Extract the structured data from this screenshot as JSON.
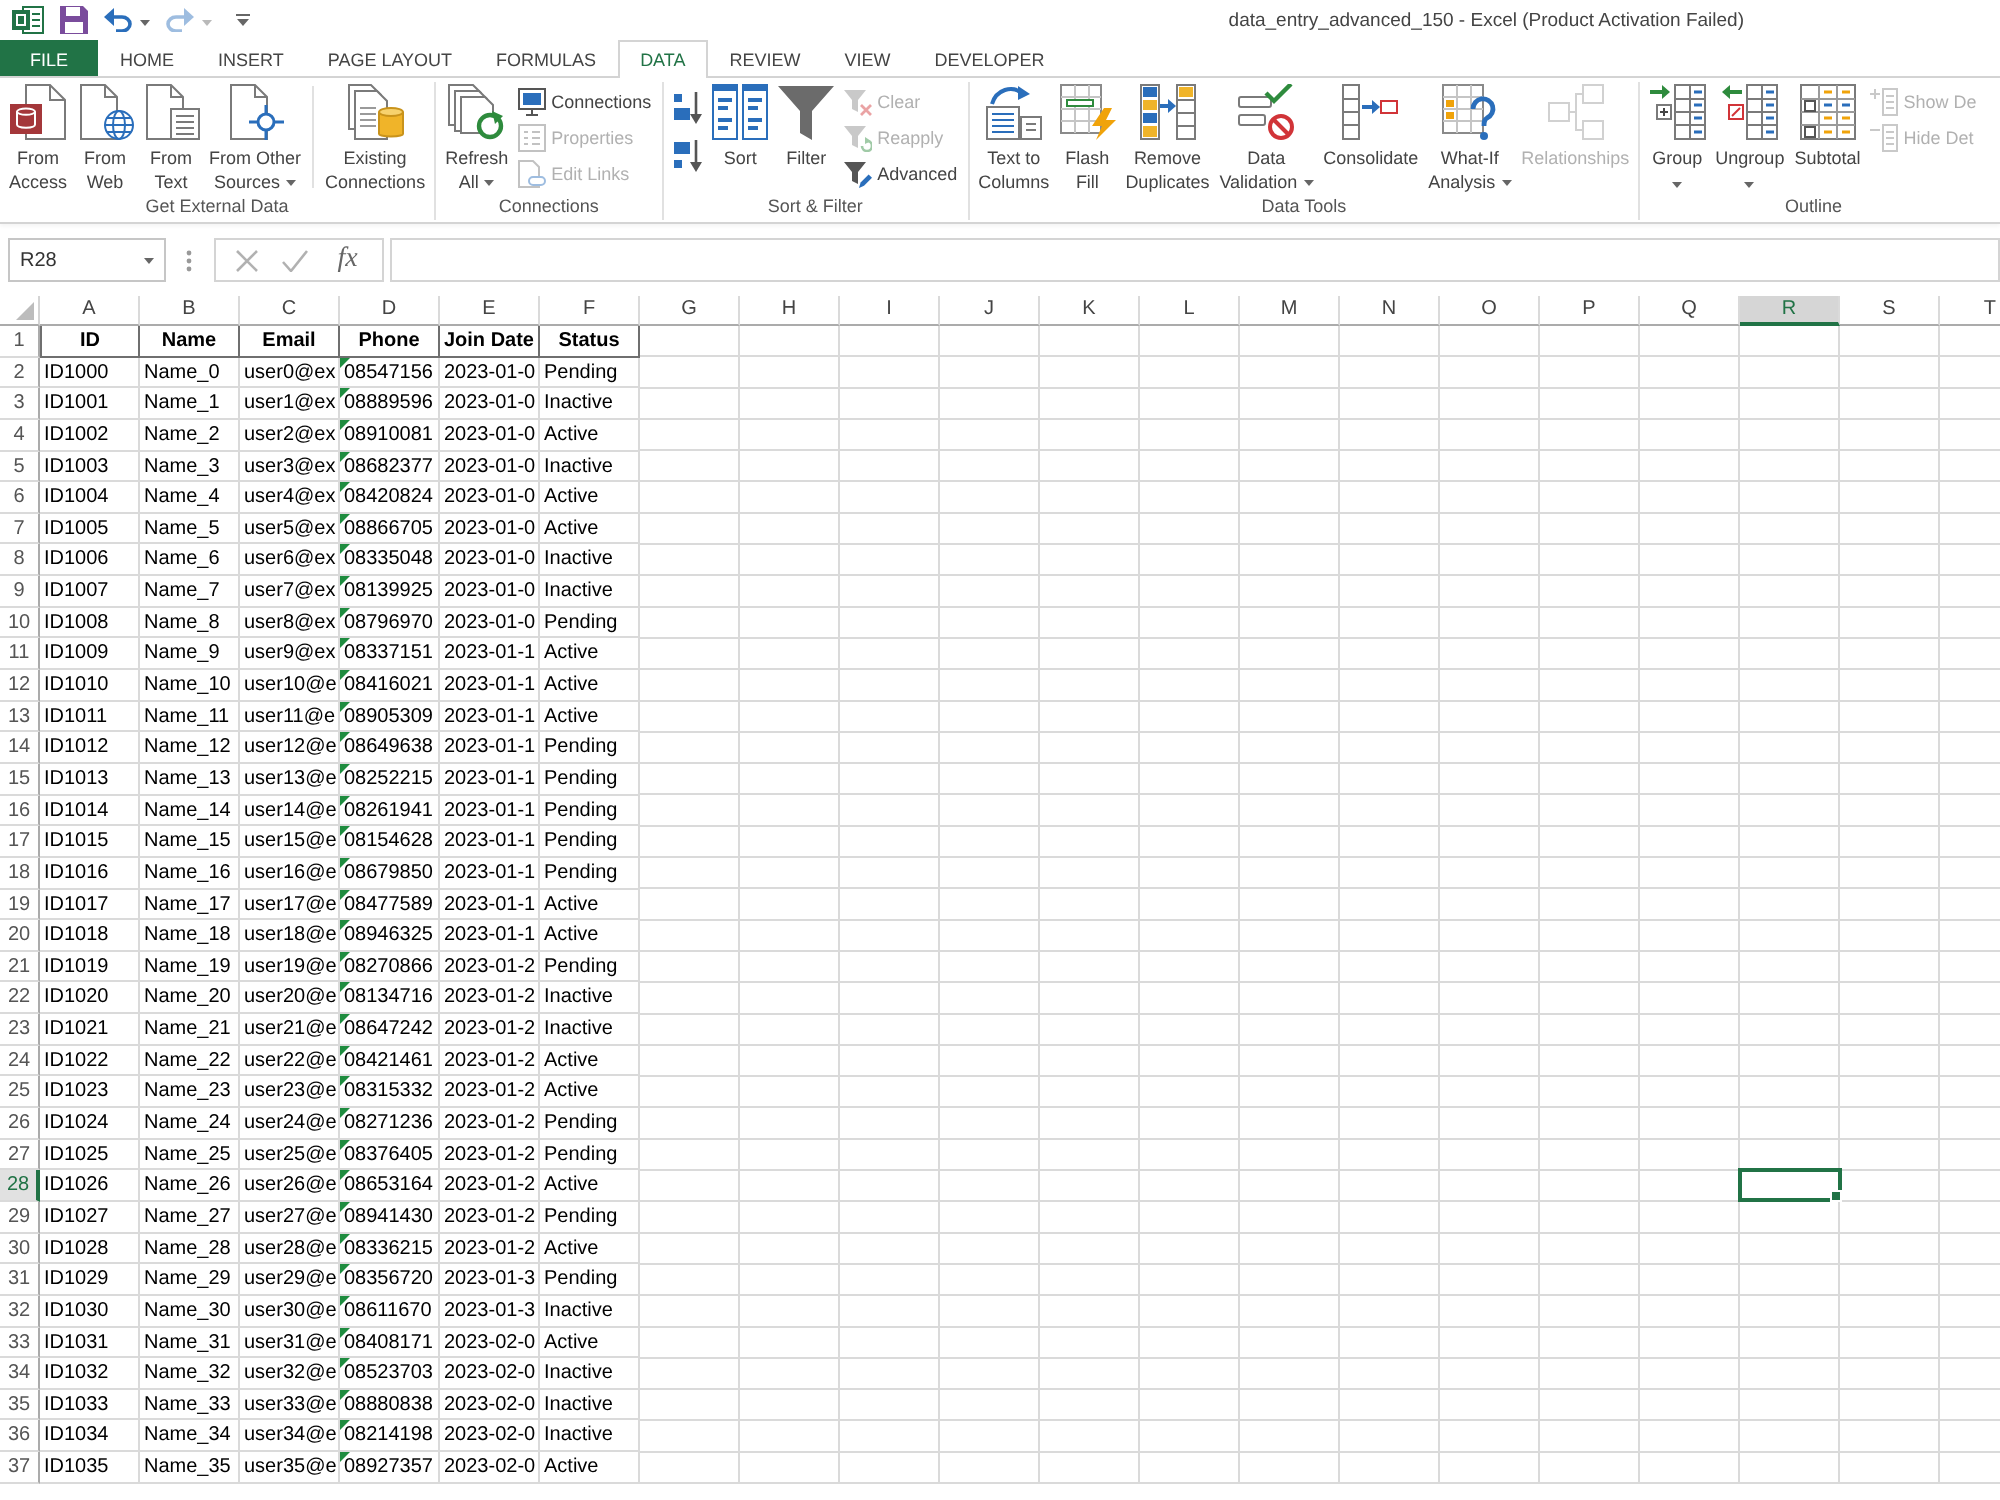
{
  "title_bar": {
    "title": "data_entry_advanced_150 - Excel (Product Activation Failed)",
    "quick_access": [
      {
        "disabled": false,
        "dropdown": false
      },
      {
        "disabled": false,
        "dropdown": true
      },
      {
        "disabled": true,
        "dropdown": true
      }
    ]
  },
  "tabs": [
    {
      "label": "FILE",
      "kind": "file",
      "selected": false
    },
    {
      "label": "HOME",
      "kind": "tab",
      "selected": false
    },
    {
      "label": "INSERT",
      "kind": "tab",
      "selected": false
    },
    {
      "label": "PAGE LAYOUT",
      "kind": "tab",
      "selected": false
    },
    {
      "label": "FORMULAS",
      "kind": "tab",
      "selected": false
    },
    {
      "label": "DATA",
      "kind": "tab",
      "selected": true
    },
    {
      "label": "REVIEW",
      "kind": "tab",
      "selected": false
    },
    {
      "label": "VIEW",
      "kind": "tab",
      "selected": false
    },
    {
      "label": "DEVELOPER",
      "kind": "tab",
      "selected": false
    }
  ],
  "ribbon": {
    "groups": [
      {
        "label": "Get External Data",
        "items": [
          {
            "kind": "large",
            "lines": [
              "From",
              "Access"
            ],
            "dropdown": false,
            "disabled": false
          },
          {
            "kind": "large",
            "lines": [
              "From",
              "Web"
            ],
            "dropdown": false,
            "disabled": false
          },
          {
            "kind": "large",
            "lines": [
              "From",
              "Text"
            ],
            "dropdown": false,
            "disabled": false
          },
          {
            "kind": "large",
            "lines": [
              "From Other",
              "Sources"
            ],
            "dropdown": true,
            "disabled": false
          },
          {
            "kind": "separator"
          },
          {
            "kind": "large",
            "lines": [
              "Existing",
              "Connections"
            ],
            "dropdown": false,
            "disabled": false
          }
        ]
      },
      {
        "label": "Connections",
        "items": [
          {
            "kind": "large",
            "lines": [
              "Refresh",
              "All"
            ],
            "dropdown": true,
            "disabled": false
          },
          {
            "kind": "stack",
            "items": [
              {
                "label": "Connections",
                "disabled": false
              },
              {
                "label": "Properties",
                "disabled": true
              },
              {
                "label": "Edit Links",
                "disabled": true
              }
            ]
          }
        ]
      },
      {
        "label": "Sort & Filter",
        "items": [
          {
            "kind": "stack",
            "items": [
              {
                "disabled": false
              },
              {
                "disabled": false
              }
            ]
          },
          {
            "kind": "large",
            "lines": [
              "Sort"
            ],
            "dropdown": false,
            "disabled": false
          },
          {
            "kind": "large",
            "lines": [
              "Filter"
            ],
            "dropdown": false,
            "disabled": false
          },
          {
            "kind": "stack",
            "items": [
              {
                "label": "Clear",
                "disabled": true
              },
              {
                "label": "Reapply",
                "disabled": true
              },
              {
                "label": "Advanced",
                "disabled": false
              }
            ]
          }
        ]
      },
      {
        "label": "Data Tools",
        "items": [
          {
            "kind": "large",
            "lines": [
              "Text to",
              "Columns"
            ],
            "dropdown": false,
            "disabled": false
          },
          {
            "kind": "large",
            "lines": [
              "Flash",
              "Fill"
            ],
            "dropdown": false,
            "disabled": false
          },
          {
            "kind": "large",
            "lines": [
              "Remove",
              "Duplicates"
            ],
            "dropdown": false,
            "disabled": false
          },
          {
            "kind": "large",
            "lines": [
              "Data",
              "Validation"
            ],
            "dropdown": true,
            "disabled": false
          },
          {
            "kind": "large",
            "lines": [
              "Consolidate"
            ],
            "dropdown": false,
            "disabled": false
          },
          {
            "kind": "large",
            "lines": [
              "What-If",
              "Analysis"
            ],
            "dropdown": true,
            "disabled": false
          },
          {
            "kind": "large",
            "lines": [
              "Relationships"
            ],
            "dropdown": false,
            "disabled": true
          }
        ]
      },
      {
        "label": "Outline",
        "items": [
          {
            "kind": "large",
            "lines": [
              "Group"
            ],
            "dropdown": true,
            "disabled": false
          },
          {
            "kind": "large",
            "lines": [
              "Ungroup"
            ],
            "dropdown": true,
            "disabled": false
          },
          {
            "kind": "large",
            "lines": [
              "Subtotal"
            ],
            "dropdown": false,
            "disabled": false
          },
          {
            "kind": "stack",
            "items": [
              {
                "label": "Show De",
                "disabled": true
              },
              {
                "label": "Hide Det",
                "disabled": true
              }
            ]
          }
        ]
      }
    ]
  },
  "formula_bar": {
    "name_box": "R28",
    "function_label": "fx",
    "cancel": {
      "disabled": true
    },
    "enter": {
      "disabled": true
    }
  },
  "sheet": {
    "columns": [
      {
        "label": "A",
        "selected": false
      },
      {
        "label": "B",
        "selected": false
      },
      {
        "label": "C",
        "selected": false
      },
      {
        "label": "D",
        "selected": false
      },
      {
        "label": "E",
        "selected": false
      },
      {
        "label": "F",
        "selected": false
      },
      {
        "label": "G",
        "selected": false
      },
      {
        "label": "H",
        "selected": false
      },
      {
        "label": "I",
        "selected": false
      },
      {
        "label": "J",
        "selected": false
      },
      {
        "label": "K",
        "selected": false
      },
      {
        "label": "L",
        "selected": false
      },
      {
        "label": "M",
        "selected": false
      },
      {
        "label": "N",
        "selected": false
      },
      {
        "label": "O",
        "selected": false
      },
      {
        "label": "P",
        "selected": false
      },
      {
        "label": "Q",
        "selected": false
      },
      {
        "label": "R",
        "selected": true
      },
      {
        "label": "S",
        "selected": false
      },
      {
        "label": "T",
        "selected": false
      }
    ],
    "rows": [
      {
        "label": "1",
        "kind": "header",
        "selected": false,
        "cells": [
          "ID",
          "Name",
          "Email",
          "Phone",
          "Join Date",
          "Status"
        ]
      },
      {
        "label": "2",
        "kind": "data",
        "selected": false,
        "flagged": true,
        "cells": [
          "ID1000",
          "Name_0",
          "user0@ex",
          "08547156",
          "2023-01-0",
          "Pending"
        ]
      },
      {
        "label": "3",
        "kind": "data",
        "selected": false,
        "flagged": true,
        "cells": [
          "ID1001",
          "Name_1",
          "user1@ex",
          "08889596",
          "2023-01-0",
          "Inactive"
        ]
      },
      {
        "label": "4",
        "kind": "data",
        "selected": false,
        "flagged": true,
        "cells": [
          "ID1002",
          "Name_2",
          "user2@ex",
          "08910081",
          "2023-01-0",
          "Active"
        ]
      },
      {
        "label": "5",
        "kind": "data",
        "selected": false,
        "flagged": true,
        "cells": [
          "ID1003",
          "Name_3",
          "user3@ex",
          "08682377",
          "2023-01-0",
          "Inactive"
        ]
      },
      {
        "label": "6",
        "kind": "data",
        "selected": false,
        "flagged": true,
        "cells": [
          "ID1004",
          "Name_4",
          "user4@ex",
          "08420824",
          "2023-01-0",
          "Active"
        ]
      },
      {
        "label": "7",
        "kind": "data",
        "selected": false,
        "flagged": true,
        "cells": [
          "ID1005",
          "Name_5",
          "user5@ex",
          "08866705",
          "2023-01-0",
          "Active"
        ]
      },
      {
        "label": "8",
        "kind": "data",
        "selected": false,
        "flagged": true,
        "cells": [
          "ID1006",
          "Name_6",
          "user6@ex",
          "08335048",
          "2023-01-0",
          "Inactive"
        ]
      },
      {
        "label": "9",
        "kind": "data",
        "selected": false,
        "flagged": true,
        "cells": [
          "ID1007",
          "Name_7",
          "user7@ex",
          "08139925",
          "2023-01-0",
          "Inactive"
        ]
      },
      {
        "label": "10",
        "kind": "data",
        "selected": false,
        "flagged": true,
        "cells": [
          "ID1008",
          "Name_8",
          "user8@ex",
          "08796970",
          "2023-01-0",
          "Pending"
        ]
      },
      {
        "label": "11",
        "kind": "data",
        "selected": false,
        "flagged": true,
        "cells": [
          "ID1009",
          "Name_9",
          "user9@ex",
          "08337151",
          "2023-01-1",
          "Active"
        ]
      },
      {
        "label": "12",
        "kind": "data",
        "selected": false,
        "flagged": true,
        "cells": [
          "ID1010",
          "Name_10",
          "user10@e",
          "08416021",
          "2023-01-1",
          "Active"
        ]
      },
      {
        "label": "13",
        "kind": "data",
        "selected": false,
        "flagged": true,
        "cells": [
          "ID1011",
          "Name_11",
          "user11@e",
          "08905309",
          "2023-01-1",
          "Active"
        ]
      },
      {
        "label": "14",
        "kind": "data",
        "selected": false,
        "flagged": true,
        "cells": [
          "ID1012",
          "Name_12",
          "user12@e",
          "08649638",
          "2023-01-1",
          "Pending"
        ]
      },
      {
        "label": "15",
        "kind": "data",
        "selected": false,
        "flagged": true,
        "cells": [
          "ID1013",
          "Name_13",
          "user13@e",
          "08252215",
          "2023-01-1",
          "Pending"
        ]
      },
      {
        "label": "16",
        "kind": "data",
        "selected": false,
        "flagged": true,
        "cells": [
          "ID1014",
          "Name_14",
          "user14@e",
          "08261941",
          "2023-01-1",
          "Pending"
        ]
      },
      {
        "label": "17",
        "kind": "data",
        "selected": false,
        "flagged": true,
        "cells": [
          "ID1015",
          "Name_15",
          "user15@e",
          "08154628",
          "2023-01-1",
          "Pending"
        ]
      },
      {
        "label": "18",
        "kind": "data",
        "selected": false,
        "flagged": true,
        "cells": [
          "ID1016",
          "Name_16",
          "user16@e",
          "08679850",
          "2023-01-1",
          "Pending"
        ]
      },
      {
        "label": "19",
        "kind": "data",
        "selected": false,
        "flagged": true,
        "cells": [
          "ID1017",
          "Name_17",
          "user17@e",
          "08477589",
          "2023-01-1",
          "Active"
        ]
      },
      {
        "label": "20",
        "kind": "data",
        "selected": false,
        "flagged": true,
        "cells": [
          "ID1018",
          "Name_18",
          "user18@e",
          "08946325",
          "2023-01-1",
          "Active"
        ]
      },
      {
        "label": "21",
        "kind": "data",
        "selected": false,
        "flagged": true,
        "cells": [
          "ID1019",
          "Name_19",
          "user19@e",
          "08270866",
          "2023-01-2",
          "Pending"
        ]
      },
      {
        "label": "22",
        "kind": "data",
        "selected": false,
        "flagged": true,
        "cells": [
          "ID1020",
          "Name_20",
          "user20@e",
          "08134716",
          "2023-01-2",
          "Inactive"
        ]
      },
      {
        "label": "23",
        "kind": "data",
        "selected": false,
        "flagged": true,
        "cells": [
          "ID1021",
          "Name_21",
          "user21@e",
          "08647242",
          "2023-01-2",
          "Inactive"
        ]
      },
      {
        "label": "24",
        "kind": "data",
        "selected": false,
        "flagged": true,
        "cells": [
          "ID1022",
          "Name_22",
          "user22@e",
          "08421461",
          "2023-01-2",
          "Active"
        ]
      },
      {
        "label": "25",
        "kind": "data",
        "selected": false,
        "flagged": true,
        "cells": [
          "ID1023",
          "Name_23",
          "user23@e",
          "08315332",
          "2023-01-2",
          "Active"
        ]
      },
      {
        "label": "26",
        "kind": "data",
        "selected": false,
        "flagged": true,
        "cells": [
          "ID1024",
          "Name_24",
          "user24@e",
          "08271236",
          "2023-01-2",
          "Pending"
        ]
      },
      {
        "label": "27",
        "kind": "data",
        "selected": false,
        "flagged": true,
        "cells": [
          "ID1025",
          "Name_25",
          "user25@e",
          "08376405",
          "2023-01-2",
          "Pending"
        ]
      },
      {
        "label": "28",
        "kind": "data",
        "selected": true,
        "flagged": true,
        "cells": [
          "ID1026",
          "Name_26",
          "user26@e",
          "08653164",
          "2023-01-2",
          "Active"
        ]
      },
      {
        "label": "29",
        "kind": "data",
        "selected": false,
        "flagged": true,
        "cells": [
          "ID1027",
          "Name_27",
          "user27@e",
          "08941430",
          "2023-01-2",
          "Pending"
        ]
      },
      {
        "label": "30",
        "kind": "data",
        "selected": false,
        "flagged": true,
        "cells": [
          "ID1028",
          "Name_28",
          "user28@e",
          "08336215",
          "2023-01-2",
          "Active"
        ]
      },
      {
        "label": "31",
        "kind": "data",
        "selected": false,
        "flagged": true,
        "cells": [
          "ID1029",
          "Name_29",
          "user29@e",
          "08356720",
          "2023-01-3",
          "Pending"
        ]
      },
      {
        "label": "32",
        "kind": "data",
        "selected": false,
        "flagged": true,
        "cells": [
          "ID1030",
          "Name_30",
          "user30@e",
          "08611670",
          "2023-01-3",
          "Inactive"
        ]
      },
      {
        "label": "33",
        "kind": "data",
        "selected": false,
        "flagged": true,
        "cells": [
          "ID1031",
          "Name_31",
          "user31@e",
          "08408171",
          "2023-02-0",
          "Active"
        ]
      },
      {
        "label": "34",
        "kind": "data",
        "selected": false,
        "flagged": true,
        "cells": [
          "ID1032",
          "Name_32",
          "user32@e",
          "08523703",
          "2023-02-0",
          "Inactive"
        ]
      },
      {
        "label": "35",
        "kind": "data",
        "selected": false,
        "flagged": true,
        "cells": [
          "ID1033",
          "Name_33",
          "user33@e",
          "08880838",
          "2023-02-0",
          "Inactive"
        ]
      },
      {
        "label": "36",
        "kind": "data",
        "selected": false,
        "flagged": true,
        "cells": [
          "ID1034",
          "Name_34",
          "user34@e",
          "08214198",
          "2023-02-0",
          "Inactive"
        ]
      },
      {
        "label": "37",
        "kind": "data",
        "selected": false,
        "flagged": true,
        "cells": [
          "ID1035",
          "Name_35",
          "user35@e",
          "08927357",
          "2023-02-0",
          "Active"
        ]
      }
    ]
  }
}
